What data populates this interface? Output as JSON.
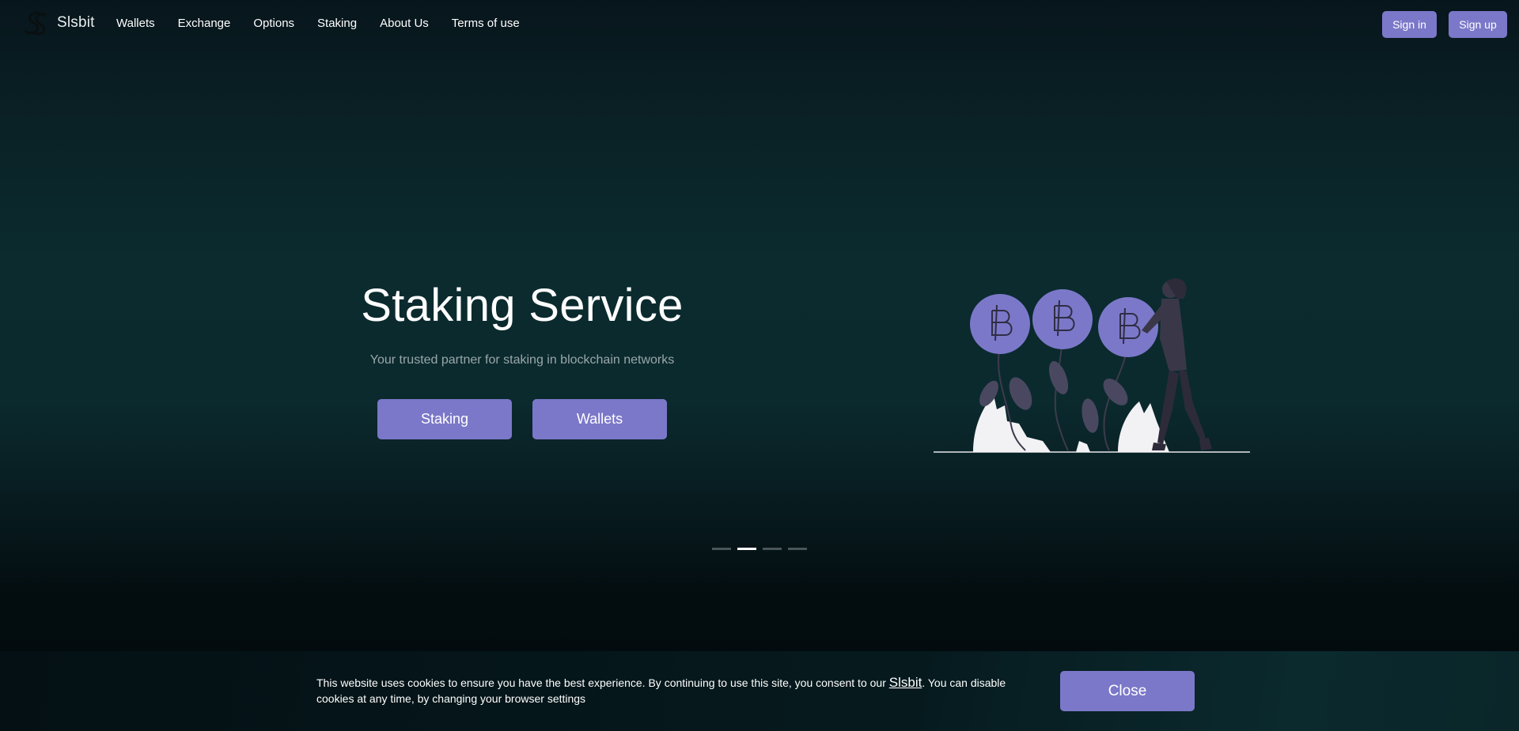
{
  "header": {
    "brand": "Slsbit",
    "nav": [
      "Wallets",
      "Exchange",
      "Options",
      "Staking",
      "About Us",
      "Terms of use"
    ],
    "signin_label": "Sign in",
    "signup_label": "Sign up"
  },
  "hero": {
    "title": "Staking Service",
    "subtitle": "Your trusted partner for staking in blockchain networks",
    "buttons": [
      "Staking",
      "Wallets"
    ],
    "illustration": "bitcoin-plants-illustration"
  },
  "carousel": {
    "slide_count": 4,
    "active_index": 1
  },
  "cookie": {
    "text_before": "This website uses cookies to ensure you have the best experience. By continuing to use this site, you consent to our ",
    "link_text": "Slsbit",
    "text_after": ". You can disable cookies at any time, by changing your browser settings",
    "close_label": "Close"
  },
  "colors": {
    "accent": "#7b78c9",
    "background": "#0b2a2e",
    "muted_text": "#9aa7aa"
  }
}
